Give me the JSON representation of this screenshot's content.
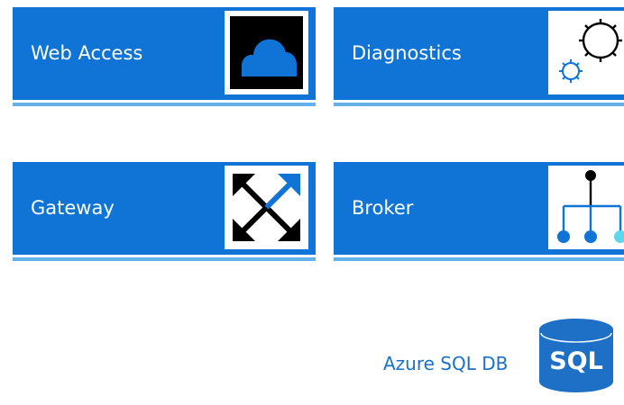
{
  "tiles": {
    "web_access": {
      "label": "Web Access",
      "icon": "cloud-icon"
    },
    "diagnostics": {
      "label": "Diagnostics",
      "icon": "gear-icon"
    },
    "gateway": {
      "label": "Gateway",
      "icon": "expand-arrows-icon"
    },
    "broker": {
      "label": "Broker",
      "icon": "hierarchy-icon"
    }
  },
  "database": {
    "label": "Azure SQL DB",
    "badge": "SQL",
    "icon": "database-cylinder-icon"
  },
  "colors": {
    "tile_blue": "#0f74d6",
    "underline_blue": "#63b1ea",
    "accent_cyan": "#59d8ee",
    "db_blue": "#1d70c6"
  }
}
